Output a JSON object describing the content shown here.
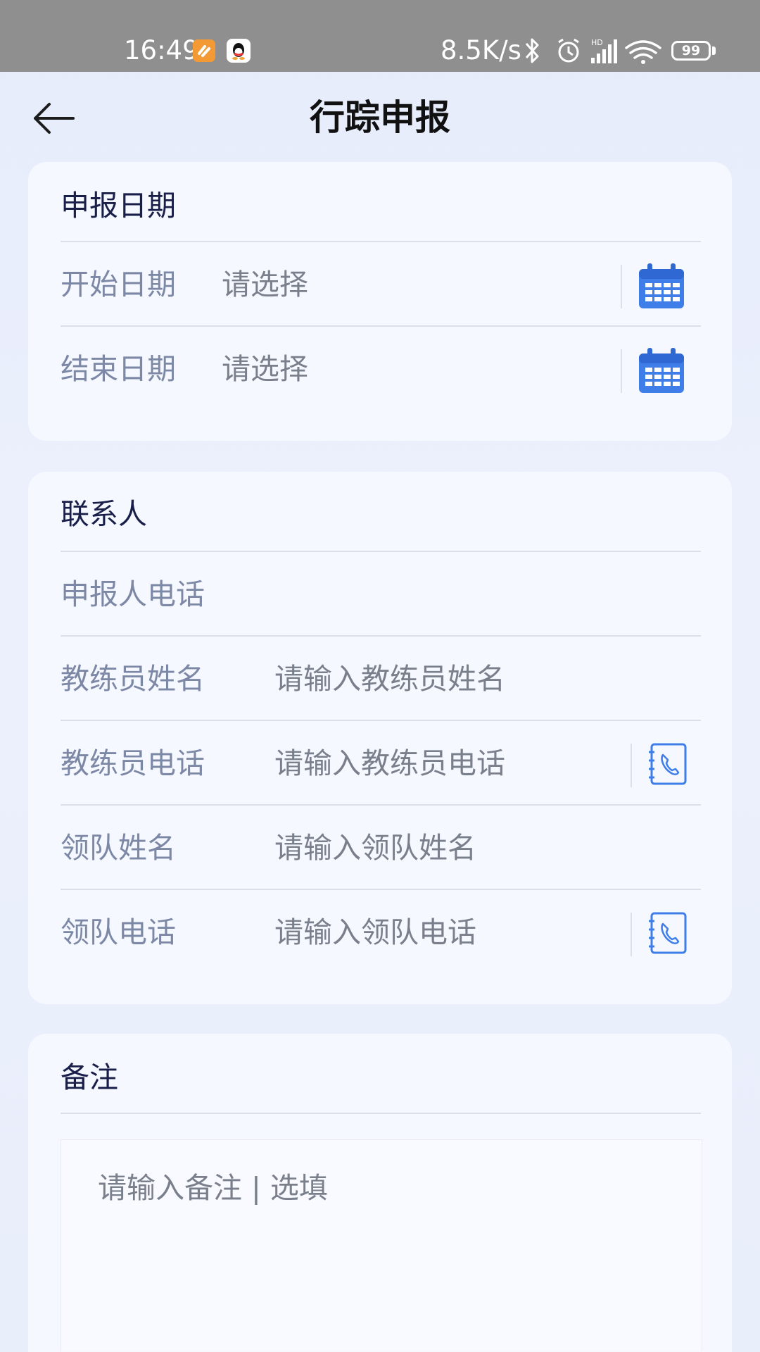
{
  "status_bar": {
    "time": "16:49",
    "network_speed": "8.5K/s",
    "battery": "99",
    "icons": [
      "bluetooth-icon",
      "alarm-icon",
      "signal-icon",
      "wifi-icon"
    ]
  },
  "header": {
    "title": "行踪申报",
    "back_icon": "arrow-left-icon"
  },
  "report_date": {
    "title": "申报日期",
    "rows": [
      {
        "label": "开始日期",
        "placeholder": "请选择",
        "icon": "calendar-icon"
      },
      {
        "label": "结束日期",
        "placeholder": "请选择",
        "icon": "calendar-icon"
      }
    ]
  },
  "contact": {
    "title": "联系人",
    "rows": [
      {
        "label": "申报人电话",
        "placeholder": ""
      },
      {
        "label": "教练员姓名",
        "placeholder": "请输入教练员姓名"
      },
      {
        "label": "教练员电话",
        "placeholder": "请输入教练员电话",
        "icon": "phone-book-icon"
      },
      {
        "label": "领队姓名",
        "placeholder": "请输入领队姓名"
      },
      {
        "label": "领队电话",
        "placeholder": "请输入领队电话",
        "icon": "phone-book-icon"
      }
    ]
  },
  "remark": {
    "title": "备注",
    "placeholder": "请输入备注 | 选填"
  },
  "colors": {
    "accent": "#3f7ee8",
    "label": "#7c88a6",
    "title": "#1a1f4a",
    "card": "#f5f8ff"
  }
}
